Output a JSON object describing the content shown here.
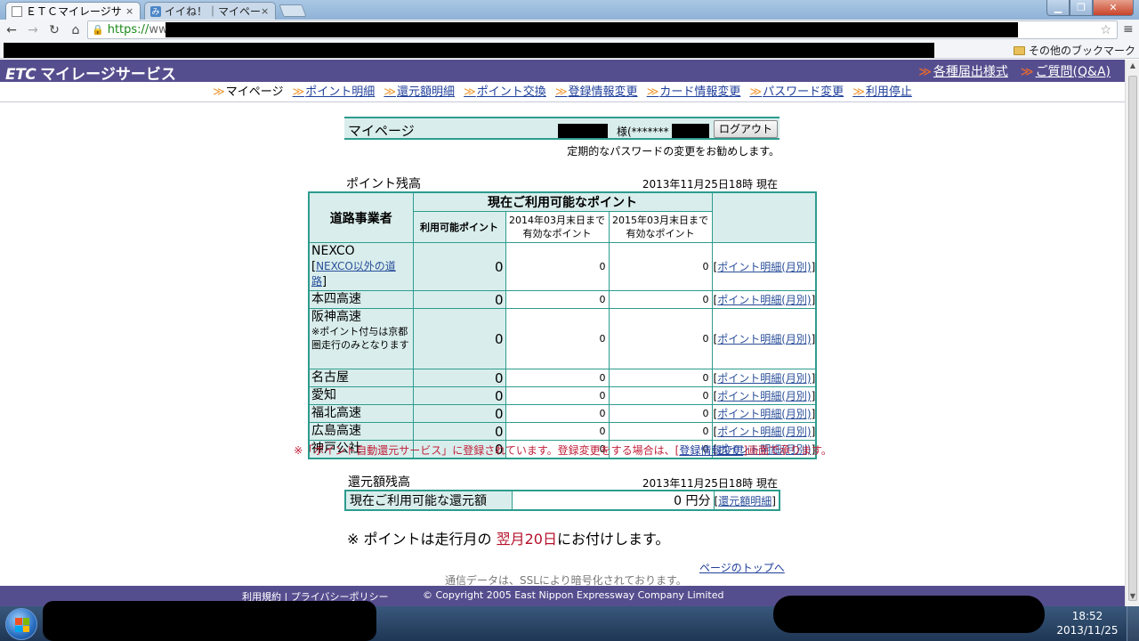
{
  "browser": {
    "tabs": [
      {
        "label": "ＥＴＣマイレージサ",
        "active": true,
        "icon": "page-icon"
      },
      {
        "label": "イイね！｜マイペー",
        "active": false,
        "icon": "site-icon"
      }
    ],
    "url_scheme": "https://",
    "url_visible": "ww",
    "bookmark_other": "その他のブックマーク"
  },
  "site": {
    "logo_etc": "ETC",
    "logo_text": "マイレージサービス",
    "header_links": [
      "各種届出様式",
      "ご質問(Q&A)"
    ],
    "nav": [
      {
        "label": "マイページ",
        "link": false
      },
      {
        "label": "ポイント明細",
        "link": true
      },
      {
        "label": "還元額明細",
        "link": true
      },
      {
        "label": "ポイント交換",
        "link": true
      },
      {
        "label": "登録情報変更",
        "link": true
      },
      {
        "label": "カード情報変更",
        "link": true
      },
      {
        "label": "パスワード変更",
        "link": true
      },
      {
        "label": "利用停止",
        "link": true
      }
    ]
  },
  "mypage": {
    "title": "マイページ",
    "user_suffix": "様(*******",
    "logout": "ログアウト",
    "password_notice": "定期的なパスワードの変更をお勧めします。"
  },
  "points": {
    "title": "ポイント残高",
    "date": "2013年11月25日18時 現在",
    "header_group": "現在ご利用可能なポイント",
    "header_operator": "道路事業者",
    "header_available": "利用可能ポイント",
    "header_2014": "2014年03月末日まで有効なポイント",
    "header_2015": "2015年03月末日まで有効なポイント",
    "rows": [
      {
        "name": "NEXCO",
        "sub_link": "NEXCO以外の道路",
        "available": "0",
        "until2014": "0",
        "until2015": "0",
        "link": "ポイント明細(月別)"
      },
      {
        "name": "本四高速",
        "available": "0",
        "until2014": "0",
        "until2015": "0",
        "link": "ポイント明細(月別)"
      },
      {
        "name": "阪神高速",
        "note": "※ポイント付与は京都圏走行のみとなります",
        "available": "0",
        "until2014": "0",
        "until2015": "0",
        "link": "ポイント明細(月別)"
      },
      {
        "name": "名古屋",
        "available": "0",
        "until2014": "0",
        "until2015": "0",
        "link": "ポイント明細(月別)"
      },
      {
        "name": "愛知",
        "available": "0",
        "until2014": "0",
        "until2015": "0",
        "link": "ポイント明細(月別)"
      },
      {
        "name": "福北高速",
        "available": "0",
        "until2014": "0",
        "until2015": "0",
        "link": "ポイント明細(月別)"
      },
      {
        "name": "広島高速",
        "available": "0",
        "until2014": "0",
        "until2015": "0",
        "link": "ポイント明細(月別)"
      },
      {
        "name": "神戸公社",
        "available": "0",
        "until2014": "0",
        "until2015": "0",
        "link": "ポイント明細(月別)"
      }
    ],
    "registration_note_pre": "※「ポイント自動還元サービス」に登録されています。登録変更をする場合は、[",
    "registration_note_link": "登録情報変更",
    "registration_note_post": "]画面で承ります。"
  },
  "cashback": {
    "title": "還元額残高",
    "date": "2013年11月25日18時 現在",
    "label": "現在ご利用可能な還元額",
    "value": "0 円分",
    "link": "還元額明細"
  },
  "grant_note": {
    "pre": "※ ポイントは走行月の ",
    "emphasis": "翌月20日",
    "post": "にお付けします。"
  },
  "page_top": "ページのトップへ",
  "ssl_note": "通信データは、SSLにより暗号化されております。",
  "footer": {
    "links": "利用規約 | プライバシーポリシー",
    "copyright": "© Copyright 2005 East Nippon Expressway Company Limited"
  },
  "taskbar": {
    "time": "18:52",
    "date": "2013/11/25"
  },
  "colors": {
    "header_purple": "#554e8e",
    "teal_border": "#2d9c8e",
    "cell_bg": "#d9eeec",
    "accent_orange": "#f46a27",
    "note_red": "#c0203a"
  }
}
